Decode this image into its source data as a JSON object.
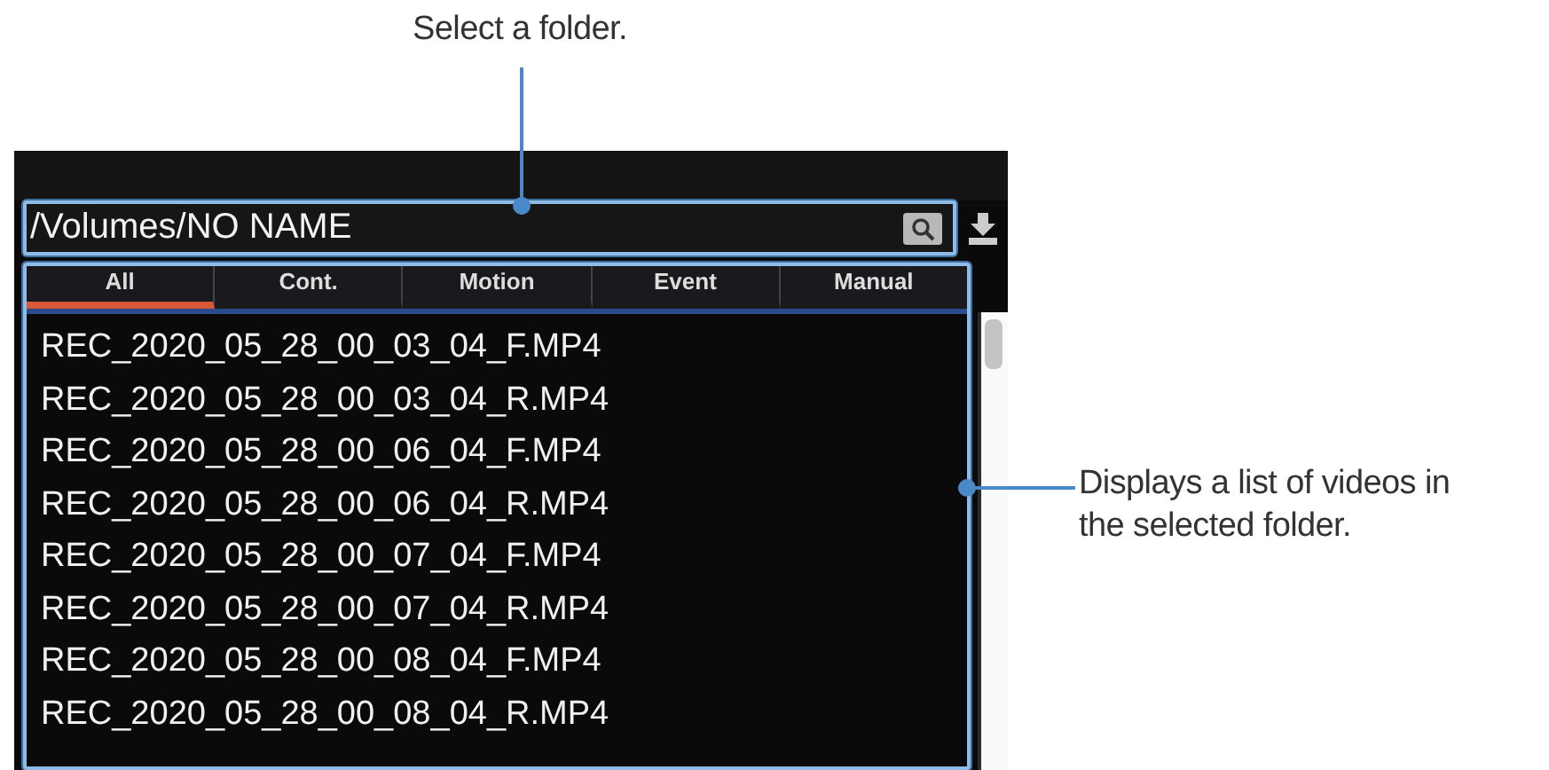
{
  "callouts": [
    {
      "text": "Select a folder."
    },
    {
      "text": "Displays a list of videos in the selected folder."
    }
  ],
  "path_bar": {
    "value": "/Volumes/NO NAME"
  },
  "tabs": [
    {
      "label": "All",
      "selected": true
    },
    {
      "label": "Cont.",
      "selected": false
    },
    {
      "label": "Motion",
      "selected": false
    },
    {
      "label": "Event",
      "selected": false
    },
    {
      "label": "Manual",
      "selected": false
    }
  ],
  "files": [
    "REC_2020_05_28_00_03_04_F.MP4",
    "REC_2020_05_28_00_03_04_R.MP4",
    "REC_2020_05_28_00_06_04_F.MP4",
    "REC_2020_05_28_00_06_04_R.MP4",
    "REC_2020_05_28_00_07_04_F.MP4",
    "REC_2020_05_28_00_07_04_R.MP4",
    "REC_2020_05_28_00_08_04_F.MP4",
    "REC_2020_05_28_00_08_04_R.MP4"
  ]
}
